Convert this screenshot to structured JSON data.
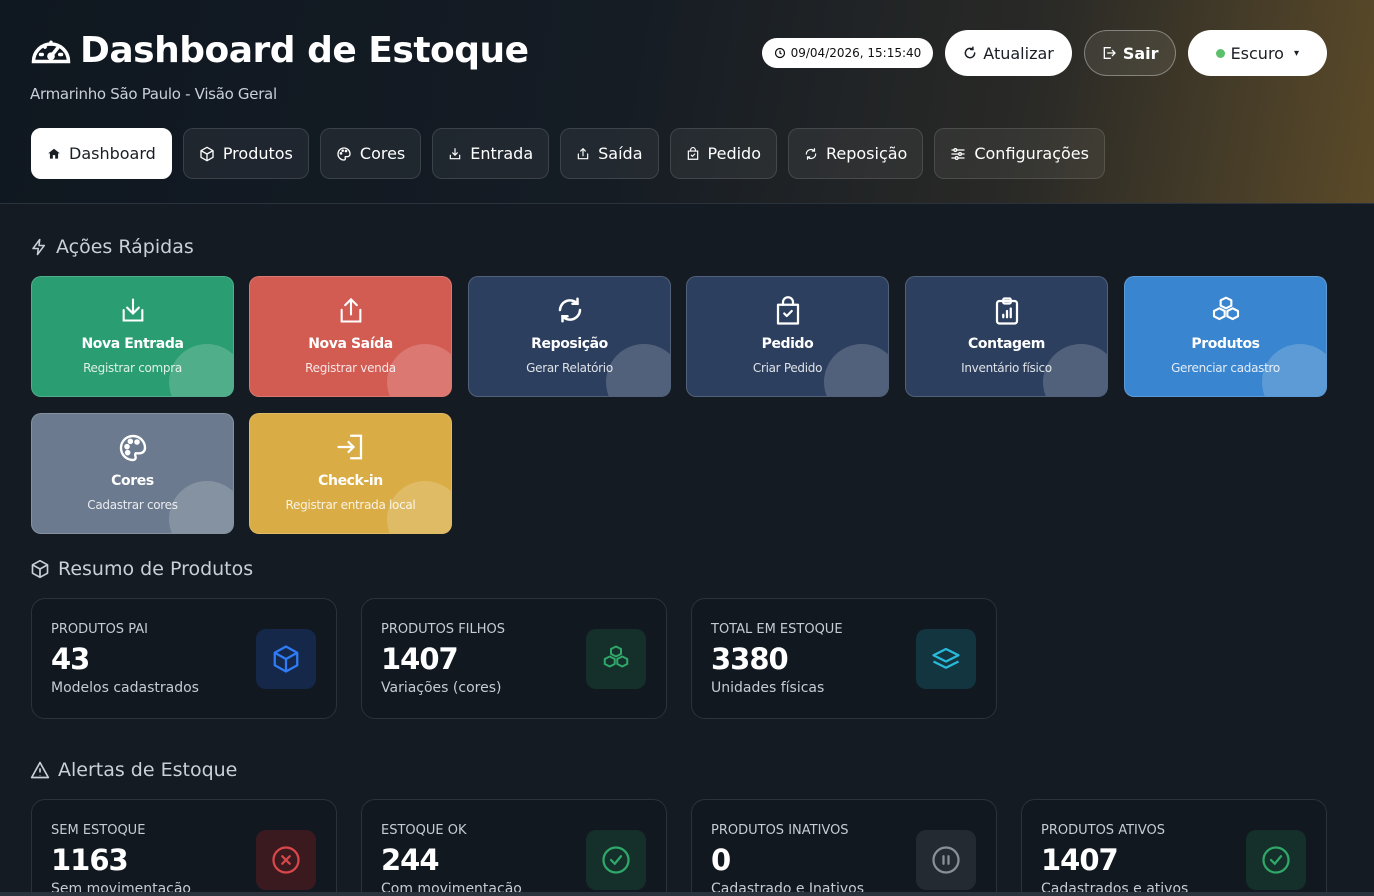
{
  "header": {
    "title": "Dashboard de Estoque",
    "subtitle": "Armarinho São Paulo - Visão Geral",
    "timestamp": "09/04/2026, 15:15:40",
    "refresh_label": "Atualizar",
    "logout_label": "Sair",
    "theme_label": "Escuro"
  },
  "nav": {
    "dashboard": "Dashboard",
    "produtos": "Produtos",
    "cores": "Cores",
    "entrada": "Entrada",
    "saida": "Saída",
    "pedido": "Pedido",
    "reposicao": "Reposição",
    "configuracoes": "Configurações"
  },
  "quick_actions": {
    "title": "Ações Rápidas",
    "items": [
      {
        "title": "Nova Entrada",
        "subtitle": "Registrar compra",
        "color": "#2a9d72",
        "icon": "download-icon"
      },
      {
        "title": "Nova Saída",
        "subtitle": "Registrar venda",
        "color": "#d25b52",
        "icon": "upload-icon"
      },
      {
        "title": "Reposição",
        "subtitle": "Gerar Relatório",
        "color": "#2c3f5f",
        "icon": "refresh-icon"
      },
      {
        "title": "Pedido",
        "subtitle": "Criar Pedido",
        "color": "#2c3f5f",
        "icon": "shopping-bag-icon"
      },
      {
        "title": "Contagem",
        "subtitle": "Inventário físico",
        "color": "#2c3f5f",
        "icon": "clipboard-chart-icon"
      },
      {
        "title": "Produtos",
        "subtitle": "Gerenciar cadastro",
        "color": "#3a85cf",
        "icon": "boxes-icon"
      },
      {
        "title": "Cores",
        "subtitle": "Cadastrar cores",
        "color": "#6b7a8e",
        "icon": "palette-icon"
      },
      {
        "title": "Check-in",
        "subtitle": "Registrar entrada local",
        "color": "#d9ac45",
        "icon": "login-icon"
      }
    ]
  },
  "summary": {
    "title": "Resumo de Produtos",
    "cards": [
      {
        "label": "PRODUTOS PAI",
        "value": "43",
        "desc": "Modelos cadastrados",
        "icon": "cube-icon",
        "color": "#2f7cf6"
      },
      {
        "label": "PRODUTOS FILHOS",
        "value": "1407",
        "desc": "Variações (cores)",
        "icon": "boxes-icon",
        "color": "#2fa86a"
      },
      {
        "label": "TOTAL EM ESTOQUE",
        "value": "3380",
        "desc": "Unidades físicas",
        "icon": "layers-icon",
        "color": "#29b9d9"
      }
    ]
  },
  "alerts": {
    "title": "Alertas de Estoque",
    "cards": [
      {
        "label": "SEM ESTOQUE",
        "value": "1163",
        "desc": "Sem movimentação",
        "icon": "x-circle-icon",
        "color": "#d8484a"
      },
      {
        "label": "ESTOQUE OK",
        "value": "244",
        "desc": "Com movimentação",
        "icon": "check-circle-icon",
        "color": "#2fa86a"
      },
      {
        "label": "PRODUTOS INATIVOS",
        "value": "0",
        "desc": "Cadastrado e Inativos",
        "icon": "pause-circle-icon",
        "color": "#8a9099"
      },
      {
        "label": "PRODUTOS ATIVOS",
        "value": "1407",
        "desc": "Cadastrados e ativos",
        "icon": "check-circle-icon",
        "color": "#2fa86a"
      }
    ]
  }
}
